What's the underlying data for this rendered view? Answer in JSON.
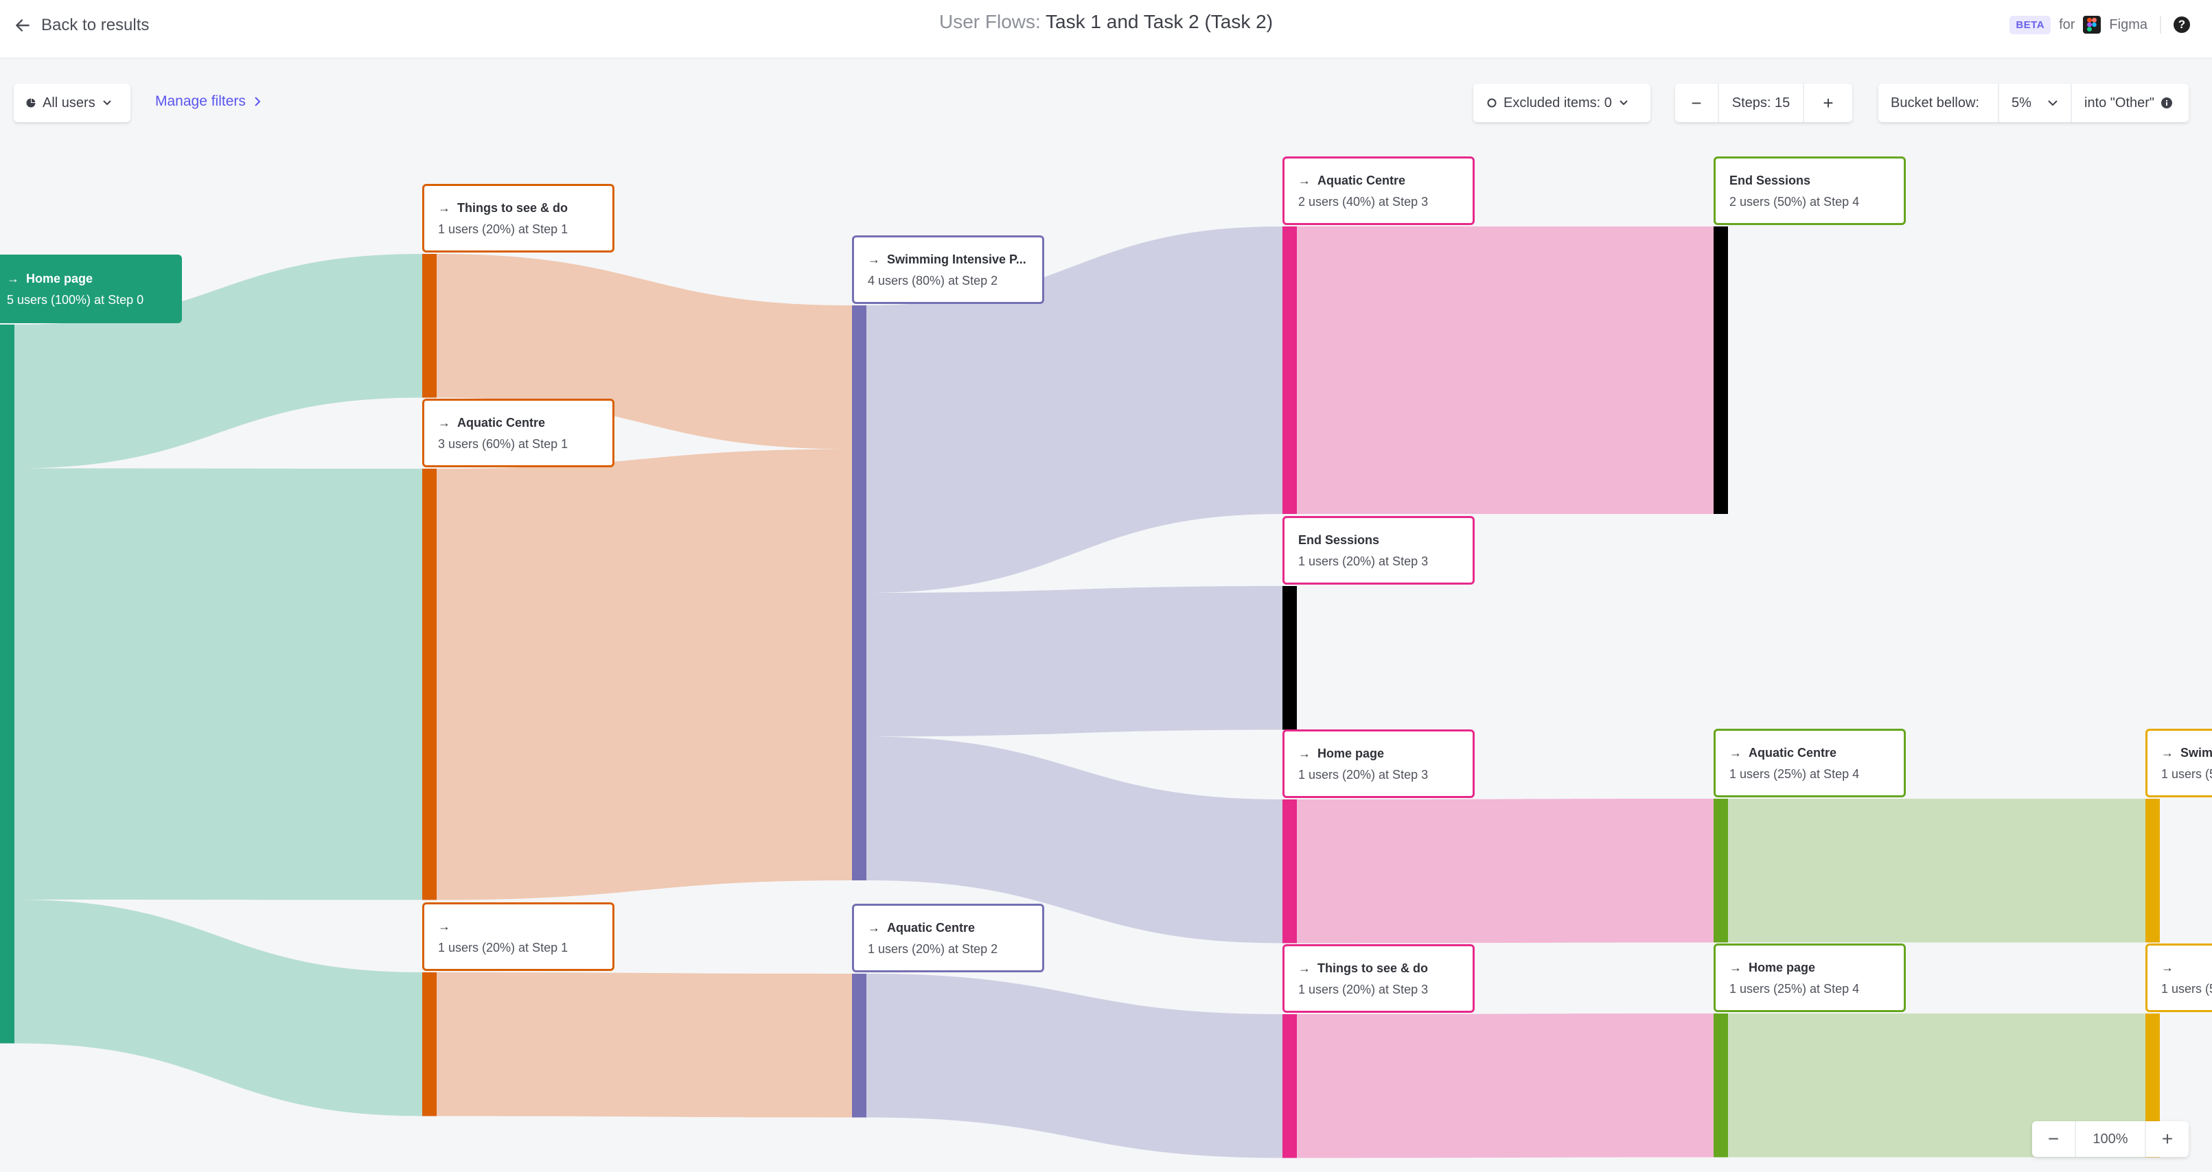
{
  "header": {
    "back_label": "Back to results",
    "title_prefix": "User Flows:",
    "title_main": "Task 1 and Task 2 (Task 2)",
    "beta_badge": "BETA",
    "for_label": "for",
    "integration_label": "Figma",
    "help_icon_label": "?"
  },
  "filters": {
    "segment_label": "All users",
    "manage_filters_label": "Manage filters",
    "excluded_items_label": "Excluded items: 0",
    "steps_decrement": "−",
    "steps_label": "Steps: 15",
    "steps_increment": "+",
    "bucket_label": "Bucket bellow:",
    "bucket_value": "5%",
    "bucket_suffix": "into \"Other\""
  },
  "zoom": {
    "out_label": "−",
    "level": "100%",
    "in_label": "+"
  },
  "colors": {
    "step0": "#1e9e77",
    "step1": "#d95f02",
    "step2": "#7570b3",
    "step3": "#e7298a",
    "step4": "#66a61e",
    "step5": "#e6ab02",
    "end": "#000000",
    "link_step0": "#b7ded3",
    "link_step1": "#efc9b3",
    "link_step2": "#cfcfe3",
    "link_step3": "#f1b7d5",
    "link_step4": "#cbdfbc",
    "link_step5": "#f1e0b6",
    "accent": "#5a55f0"
  },
  "chart_data": {
    "type": "sankey",
    "title": "User Flows: Task 1 and Task 2 (Task 2)",
    "total_users": 5,
    "nodes": [
      {
        "id": "s0_home",
        "step": 0,
        "name": "Home page",
        "arrow": true,
        "users": 5,
        "pct": "100%",
        "label": "5 users (100%) at Step 0"
      },
      {
        "id": "s1_things",
        "step": 1,
        "name": "Things to see & do",
        "arrow": true,
        "users": 1,
        "pct": "20%",
        "label": "1 users (20%) at Step 1"
      },
      {
        "id": "s1_aquatic",
        "step": 1,
        "name": "Aquatic Centre",
        "arrow": true,
        "users": 3,
        "pct": "60%",
        "label": "3 users (60%) at Step 1"
      },
      {
        "id": "s1_blank",
        "step": 1,
        "name": "",
        "arrow": true,
        "users": 1,
        "pct": "20%",
        "label": "1 users (20%) at Step 1"
      },
      {
        "id": "s2_swim",
        "step": 2,
        "name": "Swimming Intensive P...",
        "arrow": true,
        "users": 4,
        "pct": "80%",
        "label": "4 users (80%) at Step 2"
      },
      {
        "id": "s2_aquatic",
        "step": 2,
        "name": "Aquatic Centre",
        "arrow": true,
        "users": 1,
        "pct": "20%",
        "label": "1 users (20%) at Step 2"
      },
      {
        "id": "s3_aquatic",
        "step": 3,
        "name": "Aquatic Centre",
        "arrow": true,
        "users": 2,
        "pct": "40%",
        "label": "2 users (40%) at Step 3"
      },
      {
        "id": "s3_end",
        "step": 3,
        "name": "End Sessions",
        "arrow": false,
        "end": true,
        "users": 1,
        "pct": "20%",
        "label": "1 users (20%) at Step 3"
      },
      {
        "id": "s3_home",
        "step": 3,
        "name": "Home page",
        "arrow": true,
        "users": 1,
        "pct": "20%",
        "label": "1 users (20%) at Step 3"
      },
      {
        "id": "s3_things",
        "step": 3,
        "name": "Things to see & do",
        "arrow": true,
        "users": 1,
        "pct": "20%",
        "label": "1 users (20%) at Step 3"
      },
      {
        "id": "s4_end",
        "step": 4,
        "name": "End Sessions",
        "arrow": false,
        "end": true,
        "users": 2,
        "pct": "50%",
        "label": "2 users (50%) at Step 4"
      },
      {
        "id": "s4_aquatic",
        "step": 4,
        "name": "Aquatic Centre",
        "arrow": true,
        "users": 1,
        "pct": "25%",
        "label": "1 users (25%) at Step 4"
      },
      {
        "id": "s4_home",
        "step": 4,
        "name": "Home page",
        "arrow": true,
        "users": 1,
        "pct": "25%",
        "label": "1 users (25%) at Step 4"
      },
      {
        "id": "s5_swim",
        "step": 5,
        "name": "Swimm",
        "arrow": true,
        "users": 1,
        "pct": "",
        "label": "1 users (5"
      },
      {
        "id": "s5_blank",
        "step": 5,
        "name": "",
        "arrow": true,
        "users": 1,
        "pct": "",
        "label": "1 users (5"
      }
    ],
    "links": [
      {
        "source": "s0_home",
        "target": "s1_things",
        "value": 1
      },
      {
        "source": "s0_home",
        "target": "s1_aquatic",
        "value": 3
      },
      {
        "source": "s0_home",
        "target": "s1_blank",
        "value": 1
      },
      {
        "source": "s1_things",
        "target": "s2_swim",
        "value": 1
      },
      {
        "source": "s1_aquatic",
        "target": "s2_swim",
        "value": 3
      },
      {
        "source": "s1_blank",
        "target": "s2_aquatic",
        "value": 1
      },
      {
        "source": "s2_swim",
        "target": "s3_aquatic",
        "value": 2
      },
      {
        "source": "s2_swim",
        "target": "s3_end",
        "value": 1
      },
      {
        "source": "s2_swim",
        "target": "s3_home",
        "value": 1
      },
      {
        "source": "s2_aquatic",
        "target": "s3_things",
        "value": 1
      },
      {
        "source": "s3_aquatic",
        "target": "s4_end",
        "value": 2
      },
      {
        "source": "s3_home",
        "target": "s4_aquatic",
        "value": 1
      },
      {
        "source": "s3_things",
        "target": "s4_home",
        "value": 1
      },
      {
        "source": "s4_aquatic",
        "target": "s5_swim",
        "value": 1
      },
      {
        "source": "s4_home",
        "target": "s5_blank",
        "value": 1
      }
    ]
  }
}
